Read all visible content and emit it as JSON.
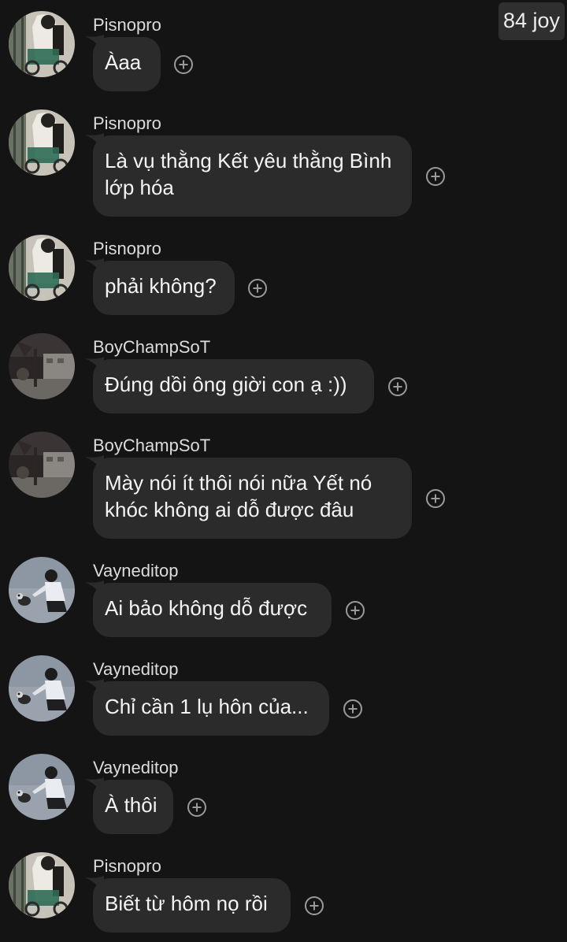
{
  "badge": {
    "text": "84 joy"
  },
  "messages": [
    {
      "sender": "Pisnopro",
      "text": "Àaa",
      "avatar": "girl-with-bicycle"
    },
    {
      "sender": "Pisnopro",
      "text": "Là vụ thằng Kết yêu thằng Bình lớp hóa",
      "avatar": "girl-with-bicycle"
    },
    {
      "sender": "Pisnopro",
      "text": "phải không?",
      "avatar": "girl-with-bicycle"
    },
    {
      "sender": "BoyChampSoT",
      "text": "Đúng dồi ông giời con ạ :))",
      "avatar": "night-street"
    },
    {
      "sender": "BoyChampSoT",
      "text": "Mày nói ít thôi nói nữa Yết nó khóc không ai dỗ được đâu",
      "avatar": "night-street"
    },
    {
      "sender": "Vayneditop",
      "text": "Ai bảo không dỗ được",
      "avatar": "boy-with-cat"
    },
    {
      "sender": "Vayneditop",
      "text": "Chỉ cần 1 lụ hôn của...",
      "avatar": "boy-with-cat"
    },
    {
      "sender": "Vayneditop",
      "text": "À thôi",
      "avatar": "boy-with-cat"
    },
    {
      "sender": "Pisnopro",
      "text": "Biết từ hôm nọ rồi",
      "avatar": "girl-with-bicycle"
    }
  ],
  "icons": {
    "reaction": "add-reaction-icon"
  },
  "colors": {
    "background": "#141414",
    "bubble": "#2b2b2b",
    "text": "#f4f4f4"
  }
}
